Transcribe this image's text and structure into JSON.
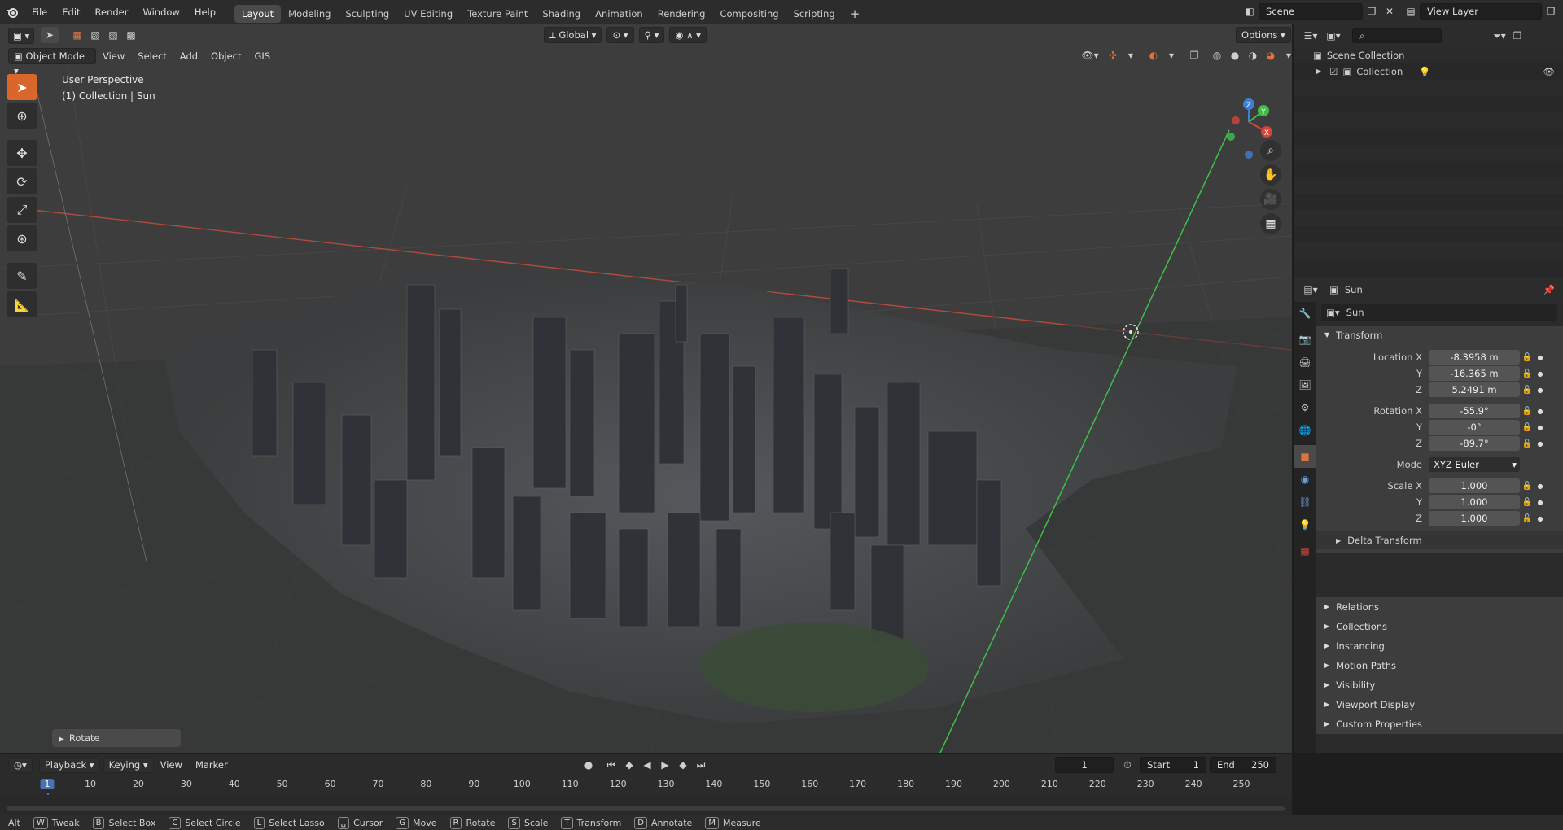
{
  "app": {
    "menus": [
      "File",
      "Edit",
      "Render",
      "Window",
      "Help"
    ],
    "workspaces": [
      "Layout",
      "Modeling",
      "Sculpting",
      "UV Editing",
      "Texture Paint",
      "Shading",
      "Animation",
      "Rendering",
      "Compositing",
      "Scripting"
    ],
    "active_workspace": "Layout",
    "scene": "Scene",
    "view_layer": "View Layer"
  },
  "viewport": {
    "mode": "Object Mode",
    "menus": [
      "View",
      "Select",
      "Add",
      "Object",
      "GIS"
    ],
    "orientation": "Global",
    "options_label": "Options",
    "info_line1": "User Perspective",
    "info_line2": "(1) Collection | Sun",
    "gizmo_axes": {
      "x": "X",
      "y": "Y",
      "z": "Z"
    },
    "rotate_panel": "Rotate",
    "colors": {
      "x_axis": "#d2453a",
      "y_axis": "#3fbf4a",
      "z_axis": "#3d7fd6",
      "accent": "#d9672b"
    }
  },
  "outliner": {
    "search_placeholder": "",
    "items": [
      {
        "label": "Scene Collection"
      },
      {
        "label": "Collection"
      }
    ]
  },
  "properties": {
    "object_name_header": "Sun",
    "object_name_field": "Sun",
    "transform_label": "Transform",
    "location": {
      "x_label": "Location X",
      "y_label": "Y",
      "z_label": "Z",
      "x": "-8.3958 m",
      "y": "-16.365 m",
      "z": "5.2491 m"
    },
    "rotation": {
      "x_label": "Rotation X",
      "y_label": "Y",
      "z_label": "Z",
      "x": "-55.9°",
      "y": "-0°",
      "z": "-89.7°"
    },
    "mode_label": "Mode",
    "mode_value": "XYZ Euler",
    "scale": {
      "x_label": "Scale X",
      "y_label": "Y",
      "z_label": "Z",
      "x": "1.000",
      "y": "1.000",
      "z": "1.000"
    },
    "delta_transform": "Delta Transform",
    "panels": [
      "Relations",
      "Collections",
      "Instancing",
      "Motion Paths",
      "Visibility",
      "Viewport Display",
      "Custom Properties"
    ]
  },
  "timeline": {
    "menus": [
      "Playback",
      "Keying",
      "View",
      "Marker"
    ],
    "current_frame": "1",
    "start_label": "Start",
    "start": "1",
    "end_label": "End",
    "end": "250",
    "ticks": [
      "1",
      "10",
      "20",
      "30",
      "40",
      "50",
      "60",
      "70",
      "80",
      "90",
      "100",
      "110",
      "120",
      "130",
      "140",
      "150",
      "160",
      "170",
      "180",
      "190",
      "200",
      "210",
      "220",
      "230",
      "240",
      "250"
    ]
  },
  "statusbar": {
    "items": [
      {
        "key": "",
        "label": "Alt"
      },
      {
        "key": "W",
        "label": "Tweak"
      },
      {
        "key": "B",
        "label": "Select Box"
      },
      {
        "key": "C",
        "label": "Select Circle"
      },
      {
        "key": "L",
        "label": "Select Lasso"
      },
      {
        "key": "␣",
        "label": "Cursor"
      },
      {
        "key": "G",
        "label": "Move"
      },
      {
        "key": "R",
        "label": "Rotate"
      },
      {
        "key": "S",
        "label": "Scale"
      },
      {
        "key": "T",
        "label": "Transform"
      },
      {
        "key": "D",
        "label": "Annotate"
      },
      {
        "key": "M",
        "label": "Measure"
      }
    ]
  }
}
